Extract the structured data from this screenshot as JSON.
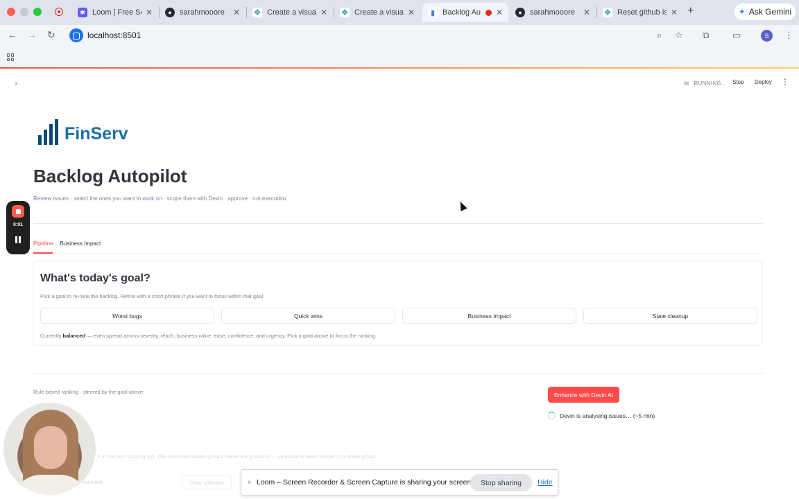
{
  "browser": {
    "tabs": [
      {
        "title": "Loom | Free Sc",
        "icon": "loom-icon",
        "color": "#625df5"
      },
      {
        "title": "sarahmooore",
        "icon": "github-icon",
        "color": "#24292f"
      },
      {
        "title": "Create a visual",
        "icon": "devin-icon",
        "color": "#2aa198"
      },
      {
        "title": "Create a visual",
        "icon": "devin-icon",
        "color": "#2aa198"
      },
      {
        "title": "Backlog Au",
        "icon": "chart-icon",
        "color": "#4a7fd4"
      },
      {
        "title": "sarahmooore",
        "icon": "github-icon",
        "color": "#24292f"
      },
      {
        "title": "Reset github is",
        "icon": "devin-icon",
        "color": "#2aa198"
      }
    ],
    "gemini_label": "Ask Gemini",
    "url": "localhost:8501",
    "profile_initial": "S"
  },
  "streamlit_header": {
    "status": "RUNNING...",
    "stop_label": "Stop",
    "deploy_label": "Deploy"
  },
  "logo": {
    "brand": "FinServ"
  },
  "page": {
    "title": "Backlog Autopilot",
    "subtitle": "Review issues · select the ones you want to work on · scope them with Devin · approve · run execution.",
    "tabs": [
      "Pipeline",
      "Business Impact"
    ],
    "active_tab": "Pipeline"
  },
  "goal_card": {
    "heading": "What's today's goal?",
    "hint": "Pick a goal to re-rank the backlog. Refine with a short phrase if you want to focus within that goal.",
    "goals": [
      "Worst bugs",
      "Quick wins",
      "Business impact",
      "Stale cleanup"
    ],
    "current_prefix": "Currently",
    "current_mode": "balanced",
    "current_suffix": "— even spread across severity, reach, business value, ease, confidence, and urgency. Pick a goal above to focus the ranking."
  },
  "ranking": {
    "caption": "Rule-based ranking · steered by the goal above",
    "enhance_label": "Enhance with Devin AI",
    "analysing_text": "Devin is analysing issues… (~5 min)",
    "faded_note": "it in the next scoping run. The recommendation groups below are guidance — selection is never locked to a single group.",
    "faded_recommended": "mended",
    "faded_clear": "Clear selection"
  },
  "loom": {
    "timer": "0:01",
    "share_message": "Loom – Screen Recorder & Screen Capture is sharing your screen.",
    "stop_sharing_label": "Stop sharing",
    "hide_label": "Hide"
  },
  "colors": {
    "accent": "#ff4b4b",
    "brand_bars": "#0c4a6e",
    "brand_text": "#1a6fa3"
  }
}
